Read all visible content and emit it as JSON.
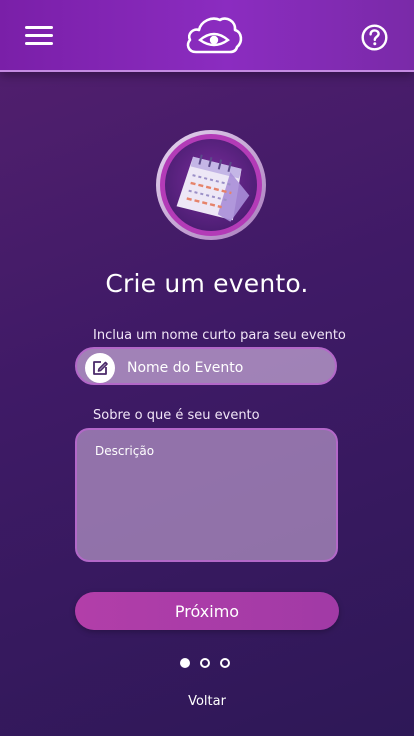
{
  "header": {
    "menu_icon": "hamburger-menu-icon",
    "logo_icon": "cloud-eye-logo-icon",
    "help_icon": "question-mark-icon"
  },
  "hero": {
    "icon": "desk-calendar-icon"
  },
  "main": {
    "title": "Crie um evento.",
    "name_label": "Inclua um nome curto para seu evento",
    "name_placeholder": "Nome do Evento",
    "description_label": "Sobre o que é seu evento",
    "description_placeholder": "Descrição",
    "next_label": "Próximo",
    "back_label": "Voltar"
  },
  "pager": {
    "total_steps": 3,
    "current_step": 1
  },
  "colors": {
    "header": "#8b2cc0",
    "background": "#3f1a66",
    "accent_button": "#b23ea9",
    "field_border": "#b368c8"
  }
}
